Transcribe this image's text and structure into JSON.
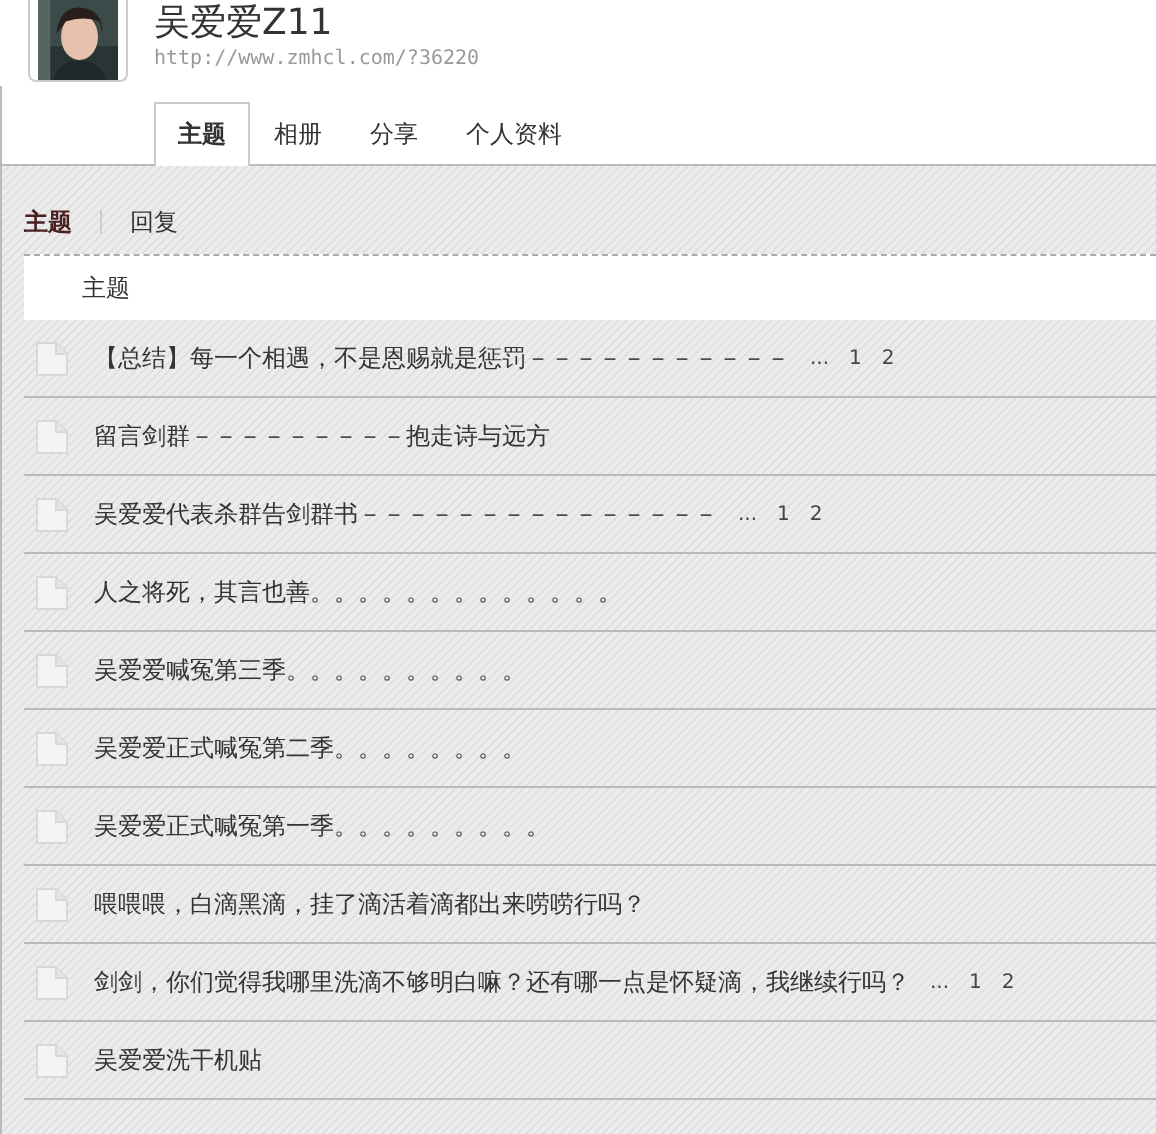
{
  "profile": {
    "name": "吴爱爱Z11",
    "url": "http://www.zmhcl.com/?36220"
  },
  "tabs": [
    {
      "label": "主题",
      "selected": true
    },
    {
      "label": "相册",
      "selected": false
    },
    {
      "label": "分享",
      "selected": false
    },
    {
      "label": "个人资料",
      "selected": false
    }
  ],
  "subtabs": [
    {
      "label": "主题",
      "selected": true
    },
    {
      "label": "回复",
      "selected": false
    }
  ],
  "table": {
    "columns": [
      "主题"
    ],
    "rows": [
      {
        "title": "【总结】每一个相遇，不是恩赐就是惩罚－－－－－－－－－－－",
        "pages": [
          "...",
          "1",
          "2"
        ]
      },
      {
        "title": "留言剑群－－－－－－－－－抱走诗与远方"
      },
      {
        "title": "吴爱爱代表杀群告剑群书－－－－－－－－－－－－－－－",
        "pages": [
          "...",
          "1",
          "2"
        ]
      },
      {
        "title": "人之将死，其言也善。。。。。。。。。。。。。"
      },
      {
        "title": "吴爱爱喊冤第三季。。。。。。。。。。"
      },
      {
        "title": "吴爱爱正式喊冤第二季。。。。。。。。"
      },
      {
        "title": "吴爱爱正式喊冤第一季。。。。。。。。。"
      },
      {
        "title": "喂喂喂，白滴黑滴，挂了滴活着滴都出来唠唠行吗？"
      },
      {
        "title": "剑剑，你们觉得我哪里洗滴不够明白嘛？还有哪一点是怀疑滴，我继续行吗？",
        "pages": [
          "...",
          "1",
          "2"
        ]
      },
      {
        "title": "吴爱爱洗干机贴"
      }
    ]
  }
}
